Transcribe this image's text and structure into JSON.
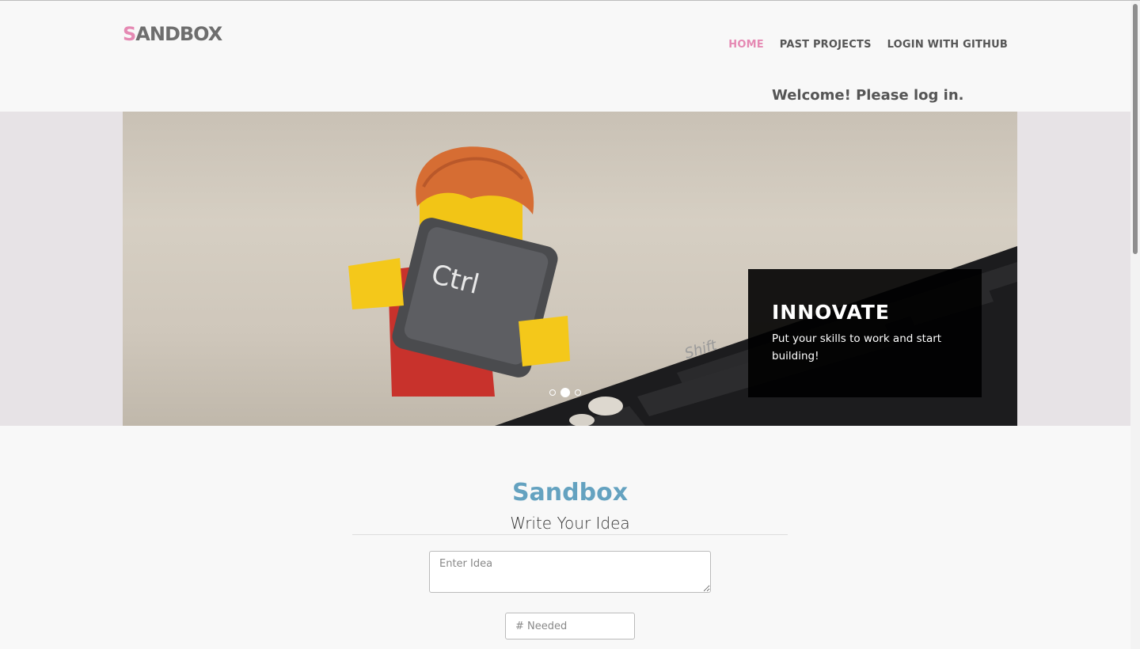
{
  "header": {
    "logo_initial": "S",
    "logo_rest": "ANDBOX",
    "nav": [
      {
        "label": "HOME",
        "active": true
      },
      {
        "label": "PAST PROJECTS",
        "active": false
      },
      {
        "label": "LOGIN WITH GITHUB",
        "active": false
      }
    ],
    "welcome": "Welcome! Please log in."
  },
  "carousel": {
    "key_label": "Ctrl",
    "shift_label": "Shift",
    "caption_title": "INNOVATE",
    "caption_text": "Put your skills to work and start building!",
    "slide_count": 3,
    "active_slide": 2
  },
  "main": {
    "title": "Sandbox",
    "subtitle": "Write Your Idea",
    "idea_placeholder": "Enter Idea",
    "needed_placeholder": "# Needed"
  },
  "colors": {
    "accent_pink": "#e589b3",
    "title_blue": "#64a2c0"
  }
}
